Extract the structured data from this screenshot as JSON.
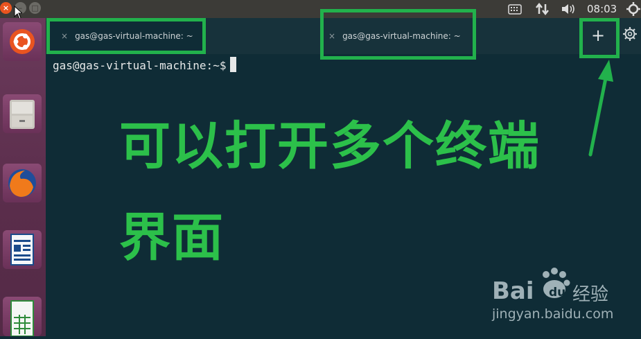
{
  "window": {
    "close_glyph": "×",
    "min_glyph": "–",
    "max_glyph": "□"
  },
  "tray": {
    "clock": "08:03"
  },
  "tabs": [
    {
      "title": "gas@gas-virtual-machine: ~",
      "close": "×"
    },
    {
      "title": "gas@gas-virtual-machine: ~",
      "close": "×"
    }
  ],
  "toolbar": {
    "new_tab": "+"
  },
  "terminal": {
    "prompt": "gas@gas-virtual-machine:~$"
  },
  "annotation": {
    "line1": "可以打开多个终端",
    "line2": "界面"
  },
  "watermark": {
    "brand_prefix": "Bai",
    "brand_suffix": "经验",
    "url": "jingyan.baidu.com"
  },
  "colors": {
    "highlight": "#22b14c",
    "annotation": "#2cc04a",
    "terminal_bg": "#0f2c36"
  }
}
